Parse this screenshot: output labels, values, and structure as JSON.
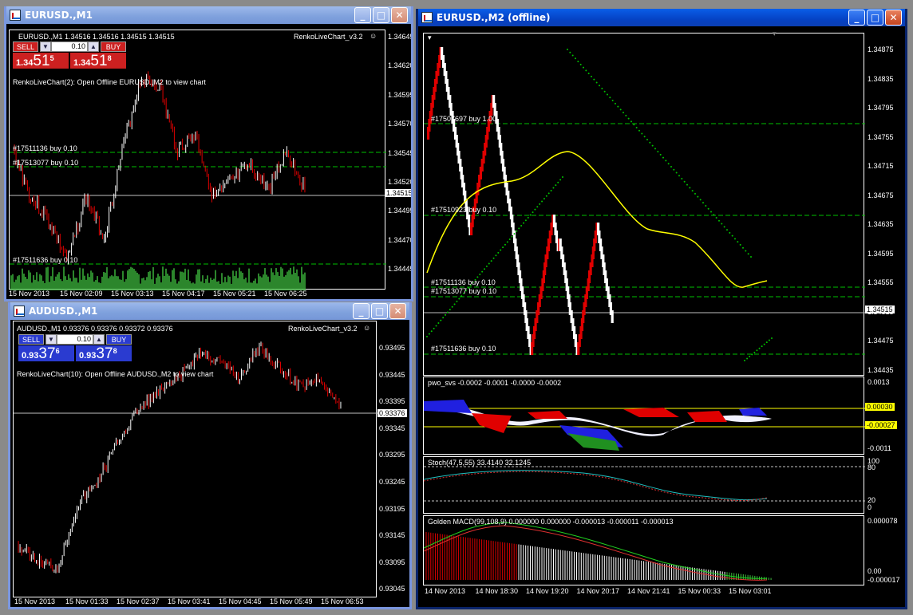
{
  "windows": {
    "eur_m1": {
      "title": "EURUSD.,M1",
      "header": "EURUSD.,M1  1.34516 1.34516 1.34515 1.34515",
      "indicator": "RenkoLiveChart_v3.2",
      "message": "RenkoLiveChart(2): Open Offline EURUSD.,M2 to view chart",
      "sell_label": "SELL",
      "buy_label": "BUY",
      "lot": "0.10",
      "sell_price_small": "1.34",
      "sell_price_big": "51",
      "sell_price_sup": "5",
      "buy_price_small": "1.34",
      "buy_price_big": "51",
      "buy_price_sup": "8",
      "y_ticks": [
        "1.34645",
        "1.34620",
        "1.34595",
        "1.34570",
        "1.34545",
        "1.34520",
        "1.34495",
        "1.34470",
        "1.34445"
      ],
      "current_price": "1.34515",
      "x_ticks": [
        "15 Nov 2013",
        "15 Nov 02:09",
        "15 Nov 03:13",
        "15 Nov 04:17",
        "15 Nov 05:21",
        "15 Nov 06:25"
      ],
      "orders": [
        "#17511136 buy 0.10",
        "#17513077 buy 0.10",
        "#17511636 buy 0.10"
      ]
    },
    "aud_m1": {
      "title": "AUDUSD.,M1",
      "header": "AUDUSD.,M1  0.93376 0.93376 0.93372 0.93376",
      "indicator": "RenkoLiveChart_v3.2",
      "message": "RenkoLiveChart(10): Open Offline AUDUSD.,M2 to view chart",
      "sell_label": "SELL",
      "buy_label": "BUY",
      "lot": "0.10",
      "sell_price_small": "0.93",
      "sell_price_big": "37",
      "sell_price_sup": "6",
      "buy_price_small": "0.93",
      "buy_price_big": "37",
      "buy_price_sup": "8",
      "y_ticks": [
        "0.93495",
        "0.93445",
        "0.93395",
        "0.93345",
        "0.93295",
        "0.93245",
        "0.93195",
        "0.93145",
        "0.93095",
        "0.93045"
      ],
      "current_price": "0.93376",
      "x_ticks": [
        "15 Nov 2013",
        "15 Nov 01:33",
        "15 Nov 02:37",
        "15 Nov 03:41",
        "15 Nov 04:45",
        "15 Nov 05:49",
        "15 Nov 06:53"
      ]
    },
    "eur_m2": {
      "title": "EURUSD.,M2 (offline)",
      "y_ticks": [
        "1.34875",
        "1.34835",
        "1.34795",
        "1.34755",
        "1.34715",
        "1.34675",
        "1.34635",
        "1.34595",
        "1.34555",
        "1.34515",
        "1.34475",
        "1.34435"
      ],
      "current_price": "1.34515",
      "orders": [
        "#17507697 buy 1.00",
        "#17510923 buy 0.10",
        "#17511136 buy 0.10",
        "#17513077 buy 0.10",
        "#17511636 buy 0.10"
      ],
      "x_ticks": [
        "14 Nov 2013",
        "14 Nov 18:30",
        "14 Nov 19:20",
        "14 Nov 20:17",
        "14 Nov 21:41",
        "15 Nov 00:33",
        "15 Nov 03:01"
      ],
      "pwo": {
        "label": "pwo_svs -0.0002 -0.0001 -0.0000 -0.0002",
        "ticks": [
          "0.0013",
          "-0.0011"
        ],
        "level_hi": "0.00030",
        "level_lo": "-0.00027"
      },
      "stoch": {
        "label": "Stoch(47,5,55) 33.4140 32.1245",
        "ticks": [
          "100",
          "80",
          "20",
          "0"
        ]
      },
      "macd": {
        "label": "Golden MACD(99,108,9) 0.000000 0.000000 -0.000013 -0.000011 -0.000013",
        "ticks": [
          "0.000078",
          "0.00",
          "-0.000017"
        ]
      }
    }
  },
  "colors": {
    "bull": "#ffffff",
    "bear": "#e00000",
    "grid": "#00c000",
    "ma": "#ffff00",
    "volume": "#40c040",
    "sell_red": "#cc2020",
    "buy_blue": "#2a3bd0"
  },
  "icons": [
    "chart-window-icon",
    "minimize-icon",
    "maximize-icon",
    "close-icon",
    "smiley-icon"
  ]
}
